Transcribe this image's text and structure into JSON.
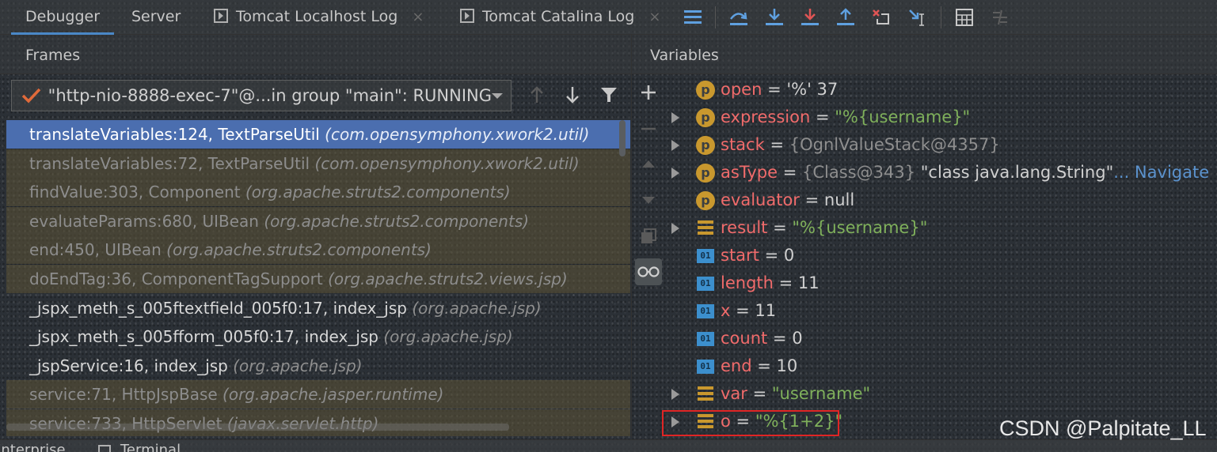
{
  "tabs": {
    "debugger": "Debugger",
    "server": "Server",
    "localhost_log": "Tomcat Localhost Log",
    "catalina_log": "Tomcat Catalina Log",
    "close_glyph": "×"
  },
  "frames_panel": {
    "title": "Frames",
    "thread": "\"http-nio-8888-exec-7\"@...in group \"main\": RUNNING",
    "frames": [
      {
        "method": "translateVariables:124, TextParseUtil ",
        "pkg": "(com.opensymphony.xwork2.util)",
        "kind": "selected"
      },
      {
        "method": "translateVariables:72, TextParseUtil ",
        "pkg": "(com.opensymphony.xwork2.util)",
        "kind": "library"
      },
      {
        "method": "findValue:303, Component ",
        "pkg": "(org.apache.struts2.components)",
        "kind": "library"
      },
      {
        "method": "evaluateParams:680, UIBean ",
        "pkg": "(org.apache.struts2.components)",
        "kind": "library"
      },
      {
        "method": "end:450, UIBean ",
        "pkg": "(org.apache.struts2.components)",
        "kind": "library"
      },
      {
        "method": "doEndTag:36, ComponentTagSupport ",
        "pkg": "(org.apache.struts2.views.jsp)",
        "kind": "library"
      },
      {
        "method": "_jspx_meth_s_005ftextfield_005f0:17, index_jsp ",
        "pkg": "(org.apache.jsp)",
        "kind": "user"
      },
      {
        "method": "_jspx_meth_s_005fform_005f0:17, index_jsp ",
        "pkg": "(org.apache.jsp)",
        "kind": "user"
      },
      {
        "method": "_jspService:16, index_jsp ",
        "pkg": "(org.apache.jsp)",
        "kind": "user"
      },
      {
        "method": "service:71, HttpJspBase ",
        "pkg": "(org.apache.jasper.runtime)",
        "kind": "library"
      },
      {
        "method": "service:733, HttpServlet ",
        "pkg": "(javax.servlet.http)",
        "kind": "library"
      }
    ]
  },
  "variables_panel": {
    "title": "Variables",
    "vars": [
      {
        "name": "open",
        "eq": " = ",
        "value": "'%' 37",
        "vclass": "plain",
        "icon": "p",
        "expandable": false
      },
      {
        "name": "expression",
        "eq": " = ",
        "value": "\"%{username}\"",
        "vclass": "str",
        "icon": "p",
        "expandable": true
      },
      {
        "name": "stack",
        "eq": " = ",
        "value": "{OgnlValueStack@4357}",
        "vclass": "obj",
        "icon": "p",
        "expandable": true
      },
      {
        "name": "asType",
        "eq": " = ",
        "value": "{Class@343} ",
        "vclass": "obj",
        "icon": "p",
        "expandable": true,
        "extra": "\"class java.lang.String\"",
        "nav": "... Navigate"
      },
      {
        "name": "evaluator",
        "eq": " = ",
        "value": "null",
        "vclass": "plain",
        "icon": "p",
        "expandable": false
      },
      {
        "name": "result",
        "eq": " = ",
        "value": "\"%{username}\"",
        "vclass": "str",
        "icon": "arr",
        "expandable": true
      },
      {
        "name": "start",
        "eq": " = ",
        "value": "0",
        "vclass": "plain",
        "icon": "prim",
        "expandable": false
      },
      {
        "name": "length",
        "eq": " = ",
        "value": "11",
        "vclass": "plain",
        "icon": "prim",
        "expandable": false
      },
      {
        "name": "x",
        "eq": " = ",
        "value": "11",
        "vclass": "plain",
        "icon": "prim",
        "expandable": false
      },
      {
        "name": "count",
        "eq": " = ",
        "value": "0",
        "vclass": "plain",
        "icon": "prim",
        "expandable": false
      },
      {
        "name": "end",
        "eq": " = ",
        "value": "10",
        "vclass": "plain",
        "icon": "prim",
        "expandable": false
      },
      {
        "name": "var",
        "eq": " = ",
        "value": "\"username\"",
        "vclass": "str",
        "icon": "arr",
        "expandable": true
      },
      {
        "name": "o",
        "eq": " = ",
        "value": "\"%{1+2}\"",
        "vclass": "str",
        "icon": "arr",
        "expandable": true
      }
    ],
    "icon_labels": {
      "p": "p",
      "prim": "01"
    }
  },
  "bottom_bar": {
    "enterprise": "Enterprise",
    "terminal": "Terminal"
  },
  "watermark": "CSDN @Palpitate_LL",
  "colors": {
    "selected_frame": "#4b6eaf",
    "library_frame": "#5d5436",
    "var_name": "#f06b6b",
    "string_value": "#7fb05b",
    "highlight_box": "#e02525"
  }
}
